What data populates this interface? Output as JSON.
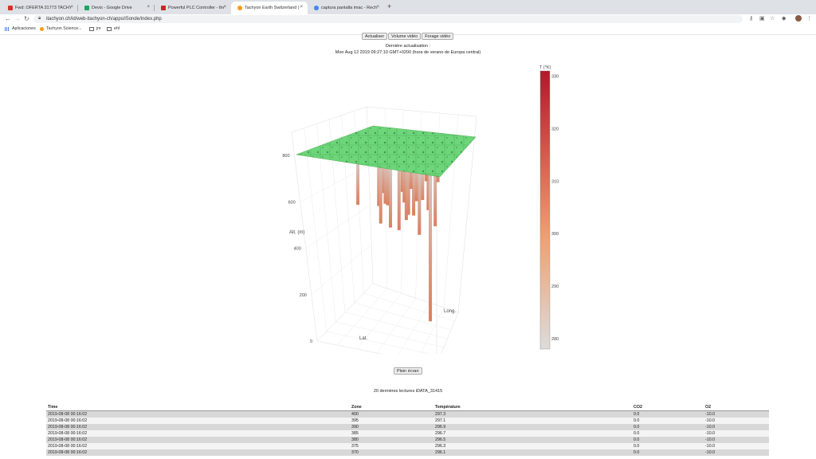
{
  "browser": {
    "tabs": [
      {
        "title": "Fwd: OFERTA 31773 TACHYON",
        "favicon": "gmail-icon",
        "color": "#d93025"
      },
      {
        "title": "Devis - Google Drive",
        "favicon": "drive-icon",
        "color": "#1fa463"
      },
      {
        "title": "Powerful PLC Controller - the",
        "favicon": "plc-icon",
        "color": "#c62828"
      },
      {
        "title": "Tachyon Earth Switzerland | ©",
        "favicon": "tachyon-icon",
        "color": "#f39c12"
      },
      {
        "title": "captura pantalla imac - Recher",
        "favicon": "google-icon",
        "color": "#4285f4"
      }
    ],
    "active_tab": 3,
    "url": "itachyon.ch/id/web-itachyon-ch/apps/iSonde/index.php",
    "bookmarks": [
      "Aplicaciones",
      "Tachyon Science...",
      "jm",
      "ehl"
    ]
  },
  "page": {
    "buttons": [
      "Actualiser",
      "Volume vidéo",
      "Forage vidéo"
    ],
    "last_update_label": "Dernière actualisation :",
    "last_update_value": "Mon Aug 12 2019 09:27:10 GMT+0200 (hora de verano de Europa central)",
    "fullscreen_label": "Plein écran",
    "table_title": "20 dernières lectures iDATA_31415",
    "table": {
      "headers": [
        "Time",
        "Zone",
        "Température",
        "CO2",
        "O2"
      ],
      "rows": [
        [
          "2019-08-08 00:16:02",
          "400",
          "297.3",
          "0.0",
          "-10.0"
        ],
        [
          "2019-08-08 00:16:02",
          "395",
          "297.1",
          "0.0",
          "-10.0"
        ],
        [
          "2019-08-08 00:16:02",
          "390",
          "296.9",
          "0.0",
          "-10.0"
        ],
        [
          "2019-08-08 00:16:02",
          "385",
          "296.7",
          "0.0",
          "-10.0"
        ],
        [
          "2019-08-08 00:16:02",
          "380",
          "296.5",
          "0.0",
          "-10.0"
        ],
        [
          "2019-08-08 00:16:02",
          "375",
          "296.3",
          "0.0",
          "-10.0"
        ],
        [
          "2019-08-08 00:16:02",
          "370",
          "296.1",
          "0.0",
          "-10.0"
        ]
      ]
    }
  },
  "chart_data": {
    "type": "scatter3d",
    "axis_titles": {
      "z": "Alt. (m)",
      "x": "Long.",
      "y": "Lat."
    },
    "z_ticks": [
      "0",
      "200",
      "400",
      "600",
      "800"
    ],
    "z_range": [
      0,
      900
    ],
    "colorbar": {
      "title": "T (°K)",
      "ticks": [
        "330",
        "320",
        "310",
        "300",
        "290",
        "280"
      ],
      "range": [
        278,
        331
      ],
      "color_low": "#dcdcdc",
      "color_mid": "#f0a070",
      "color_high": "#b2182b"
    },
    "surface_color": "#5fcf6a",
    "probes": [
      {
        "bottom_alt": 560
      },
      {
        "bottom_alt": 600
      },
      {
        "bottom_alt": 470
      },
      {
        "bottom_alt": 500
      },
      {
        "bottom_alt": 440
      },
      {
        "bottom_alt": 530
      },
      {
        "bottom_alt": 580
      },
      {
        "bottom_alt": 470
      },
      {
        "bottom_alt": 510
      },
      {
        "bottom_alt": 450
      },
      {
        "bottom_alt": 400
      },
      {
        "bottom_alt": 560
      },
      {
        "bottom_alt": 500
      },
      {
        "bottom_alt": 20
      },
      {
        "bottom_alt": 600
      },
      {
        "bottom_alt": 460
      },
      {
        "bottom_alt": 540
      },
      {
        "bottom_alt": 620
      },
      {
        "bottom_alt": 580
      },
      {
        "bottom_alt": 650
      },
      {
        "bottom_alt": 700
      },
      {
        "bottom_alt": 560
      },
      {
        "bottom_alt": 620
      },
      {
        "bottom_alt": 680
      }
    ]
  }
}
